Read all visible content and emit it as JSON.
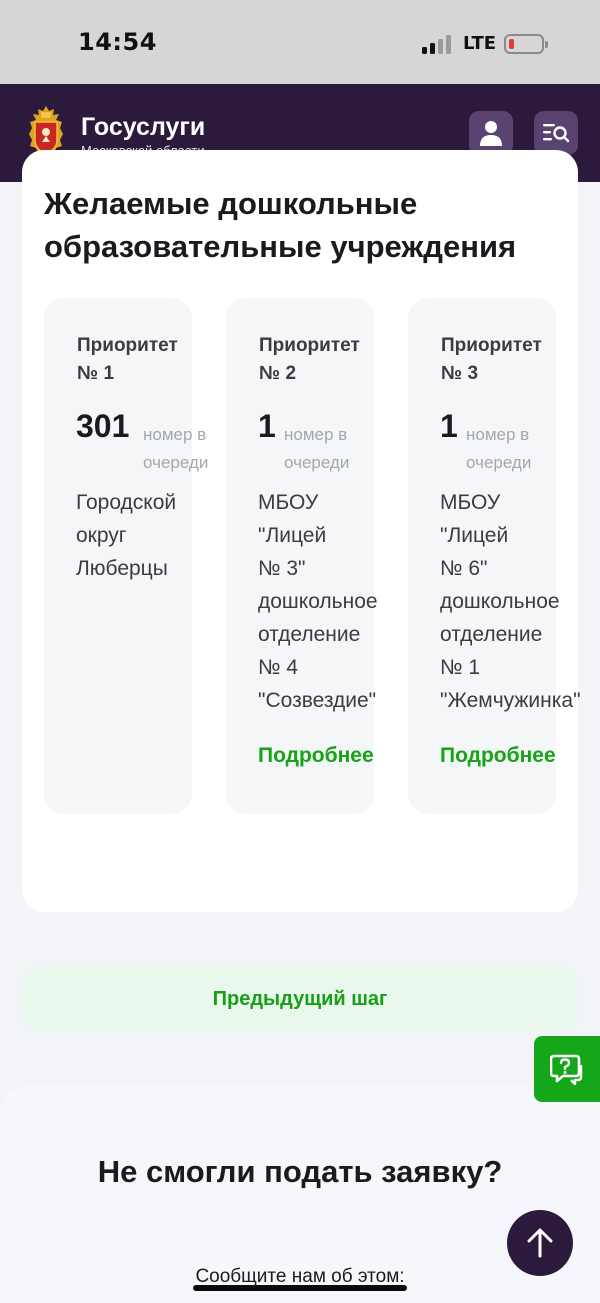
{
  "status_bar": {
    "time": "14:54",
    "network": "LTE",
    "battery_level": 0.15,
    "signal_bars_active": 2,
    "signal_bars_total": 4
  },
  "header": {
    "brand_title": "Госуслуги",
    "brand_subtitle": "Московской области",
    "profile_icon": "user-icon",
    "menu_icon": "search-menu-icon",
    "background_color": "#2c1a3d"
  },
  "section": {
    "title": "Желаемые дошкольные образовательные учреждения"
  },
  "priorities": [
    {
      "label": "Приоритет № 1",
      "queue_number": "301",
      "queue_caption": "номер в очереди",
      "name": "Городской\nокруг\nЛюберцы",
      "more_label": ""
    },
    {
      "label": "Приоритет № 2",
      "queue_number": "1",
      "queue_caption": "номер в очереди",
      "name": "МБОУ\n\"Лицей\n№ 3\"\nдошкольное\nотделение\n№ 4\n\"Созвездие\"",
      "more_label": "Подробнее"
    },
    {
      "label": "Приоритет № 3",
      "queue_number": "1",
      "queue_caption": "номер в очереди",
      "name": "МБОУ\n\"Лицей\n№ 6\"\nдошкольное\nотделение\n№ 1\n\"Жемчужинка\"",
      "more_label": "Подробнее"
    }
  ],
  "actions": {
    "previous_step": "Предыдущий шаг"
  },
  "support": {
    "icon": "chat-question-icon",
    "color": "#15a619"
  },
  "footer": {
    "title": "Не смогли подать заявку?",
    "subtitle": "Сообщите нам об этом:",
    "scroll_top_icon": "arrow-up-icon"
  },
  "colors": {
    "accent_green": "#16a316",
    "brand_purple": "#2c1a3d"
  }
}
